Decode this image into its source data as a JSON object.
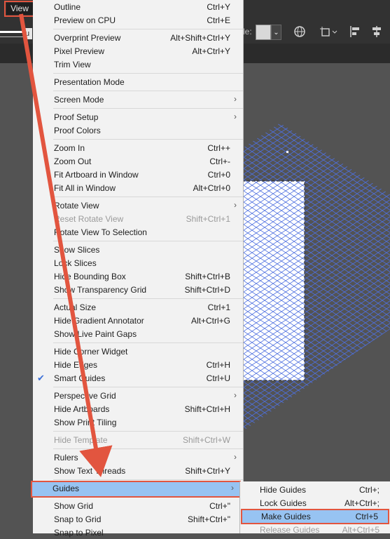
{
  "menubar": {
    "view_label": "View"
  },
  "toolbar": {
    "style_label": "le:",
    "style_dropdown": "⌄",
    "u_chip": "u"
  },
  "menu": {
    "items": [
      {
        "label": "Outline",
        "shortcut": "Ctrl+Y"
      },
      {
        "label": "Preview on CPU",
        "shortcut": "Ctrl+E"
      },
      {
        "label": "Overprint Preview",
        "shortcut": "Alt+Shift+Ctrl+Y"
      },
      {
        "label": "Pixel Preview",
        "shortcut": "Alt+Ctrl+Y"
      },
      {
        "label": "Trim View",
        "shortcut": ""
      },
      {
        "label": "Presentation Mode",
        "shortcut": ""
      },
      {
        "label": "Screen Mode",
        "shortcut": "",
        "submenu": true
      },
      {
        "label": "Proof Setup",
        "shortcut": "",
        "submenu": true
      },
      {
        "label": "Proof Colors",
        "shortcut": ""
      },
      {
        "label": "Zoom In",
        "shortcut": "Ctrl++"
      },
      {
        "label": "Zoom Out",
        "shortcut": "Ctrl+-"
      },
      {
        "label": "Fit Artboard in Window",
        "shortcut": "Ctrl+0"
      },
      {
        "label": "Fit All in Window",
        "shortcut": "Alt+Ctrl+0"
      },
      {
        "label": "Rotate View",
        "shortcut": "",
        "submenu": true
      },
      {
        "label": "Reset Rotate View",
        "shortcut": "Shift+Ctrl+1",
        "disabled": true
      },
      {
        "label": "Rotate View To Selection",
        "shortcut": ""
      },
      {
        "label": "Show Slices",
        "shortcut": ""
      },
      {
        "label": "Lock Slices",
        "shortcut": ""
      },
      {
        "label": "Hide Bounding Box",
        "shortcut": "Shift+Ctrl+B"
      },
      {
        "label": "Show Transparency Grid",
        "shortcut": "Shift+Ctrl+D"
      },
      {
        "label": "Actual Size",
        "shortcut": "Ctrl+1"
      },
      {
        "label": "Hide Gradient Annotator",
        "shortcut": "Alt+Ctrl+G"
      },
      {
        "label": "Show Live Paint Gaps",
        "shortcut": ""
      },
      {
        "label": "Hide Corner Widget",
        "shortcut": ""
      },
      {
        "label": "Hide Edges",
        "shortcut": "Ctrl+H"
      },
      {
        "label": "Smart Guides",
        "shortcut": "Ctrl+U",
        "checked": true
      },
      {
        "label": "Perspective Grid",
        "shortcut": "",
        "submenu": true
      },
      {
        "label": "Hide Artboards",
        "shortcut": "Shift+Ctrl+H"
      },
      {
        "label": "Show Print Tiling",
        "shortcut": ""
      },
      {
        "label": "Hide Template",
        "shortcut": "Shift+Ctrl+W",
        "disabled": true
      },
      {
        "label": "Rulers",
        "shortcut": "",
        "submenu": true
      },
      {
        "label": "Show Text Threads",
        "shortcut": "Shift+Ctrl+Y"
      },
      {
        "label": "Guides",
        "shortcut": "",
        "submenu": true,
        "highlighted": true
      },
      {
        "label": "Show Grid",
        "shortcut": "Ctrl+\""
      },
      {
        "label": "Snap to Grid",
        "shortcut": "Shift+Ctrl+\""
      },
      {
        "label": "Snap to Pixel",
        "shortcut": ""
      }
    ]
  },
  "submenu": {
    "items": [
      {
        "label": "Hide Guides",
        "shortcut": "Ctrl+;"
      },
      {
        "label": "Lock Guides",
        "shortcut": "Alt+Ctrl+;"
      },
      {
        "label": "Make Guides",
        "shortcut": "Ctrl+5",
        "highlighted": true
      },
      {
        "label": "Release Guides",
        "shortcut": "Alt+Ctrl+5",
        "disabled": true
      }
    ]
  },
  "icons": {
    "check": "checkmark-icon",
    "arrow": "chevron-right-icon"
  },
  "colors": {
    "menu_bg": "#f2f2f2",
    "highlight": "#97c3f2",
    "annotation": "#e2553f",
    "grid_line": "#4d6fe0",
    "canvas": "#535353",
    "toolbar": "#323232"
  }
}
